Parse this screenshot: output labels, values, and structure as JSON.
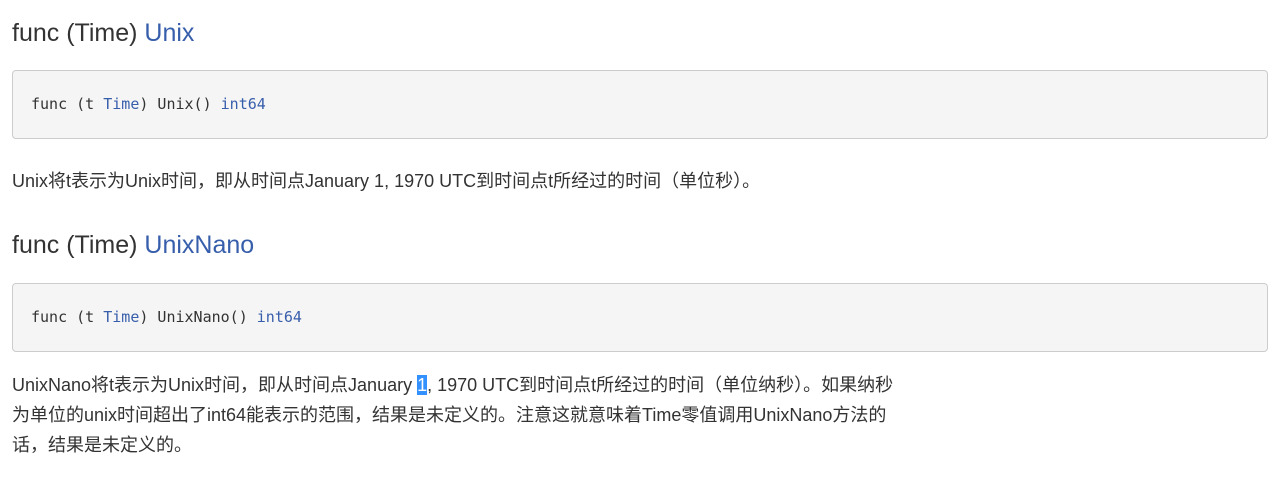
{
  "sections": [
    {
      "heading_prefix": "func (Time) ",
      "heading_link": "Unix",
      "sig_func": "func (t ",
      "sig_type": "Time",
      "sig_mid": ") Unix() ",
      "sig_ret": "int64",
      "description": "Unix将t表示为Unix时间，即从时间点January 1, 1970 UTC到时间点t所经过的时间（单位秒）。"
    },
    {
      "heading_prefix": "func (Time) ",
      "heading_link": "UnixNano",
      "sig_func": "func (t ",
      "sig_type": "Time",
      "sig_mid": ") UnixNano() ",
      "sig_ret": "int64",
      "desc_before": "UnixNano将t表示为Unix时间，即从时间点January ",
      "desc_selected": "1",
      "desc_line1_after": ", 1970 UTC到时间点t所经过的时间（单位纳秒）。如果纳秒",
      "desc_line2": "为单位的unix时间超出了int64能表示的范围，结果是未定义的。注意这就意味着Time零值调用UnixNano方法的",
      "desc_line3": "话，结果是未定义的。"
    }
  ],
  "colors": {
    "link": "#375eab",
    "text": "#333333",
    "code_bg": "#f5f5f5",
    "code_border": "#cccccc",
    "selection": "#3390ff"
  }
}
